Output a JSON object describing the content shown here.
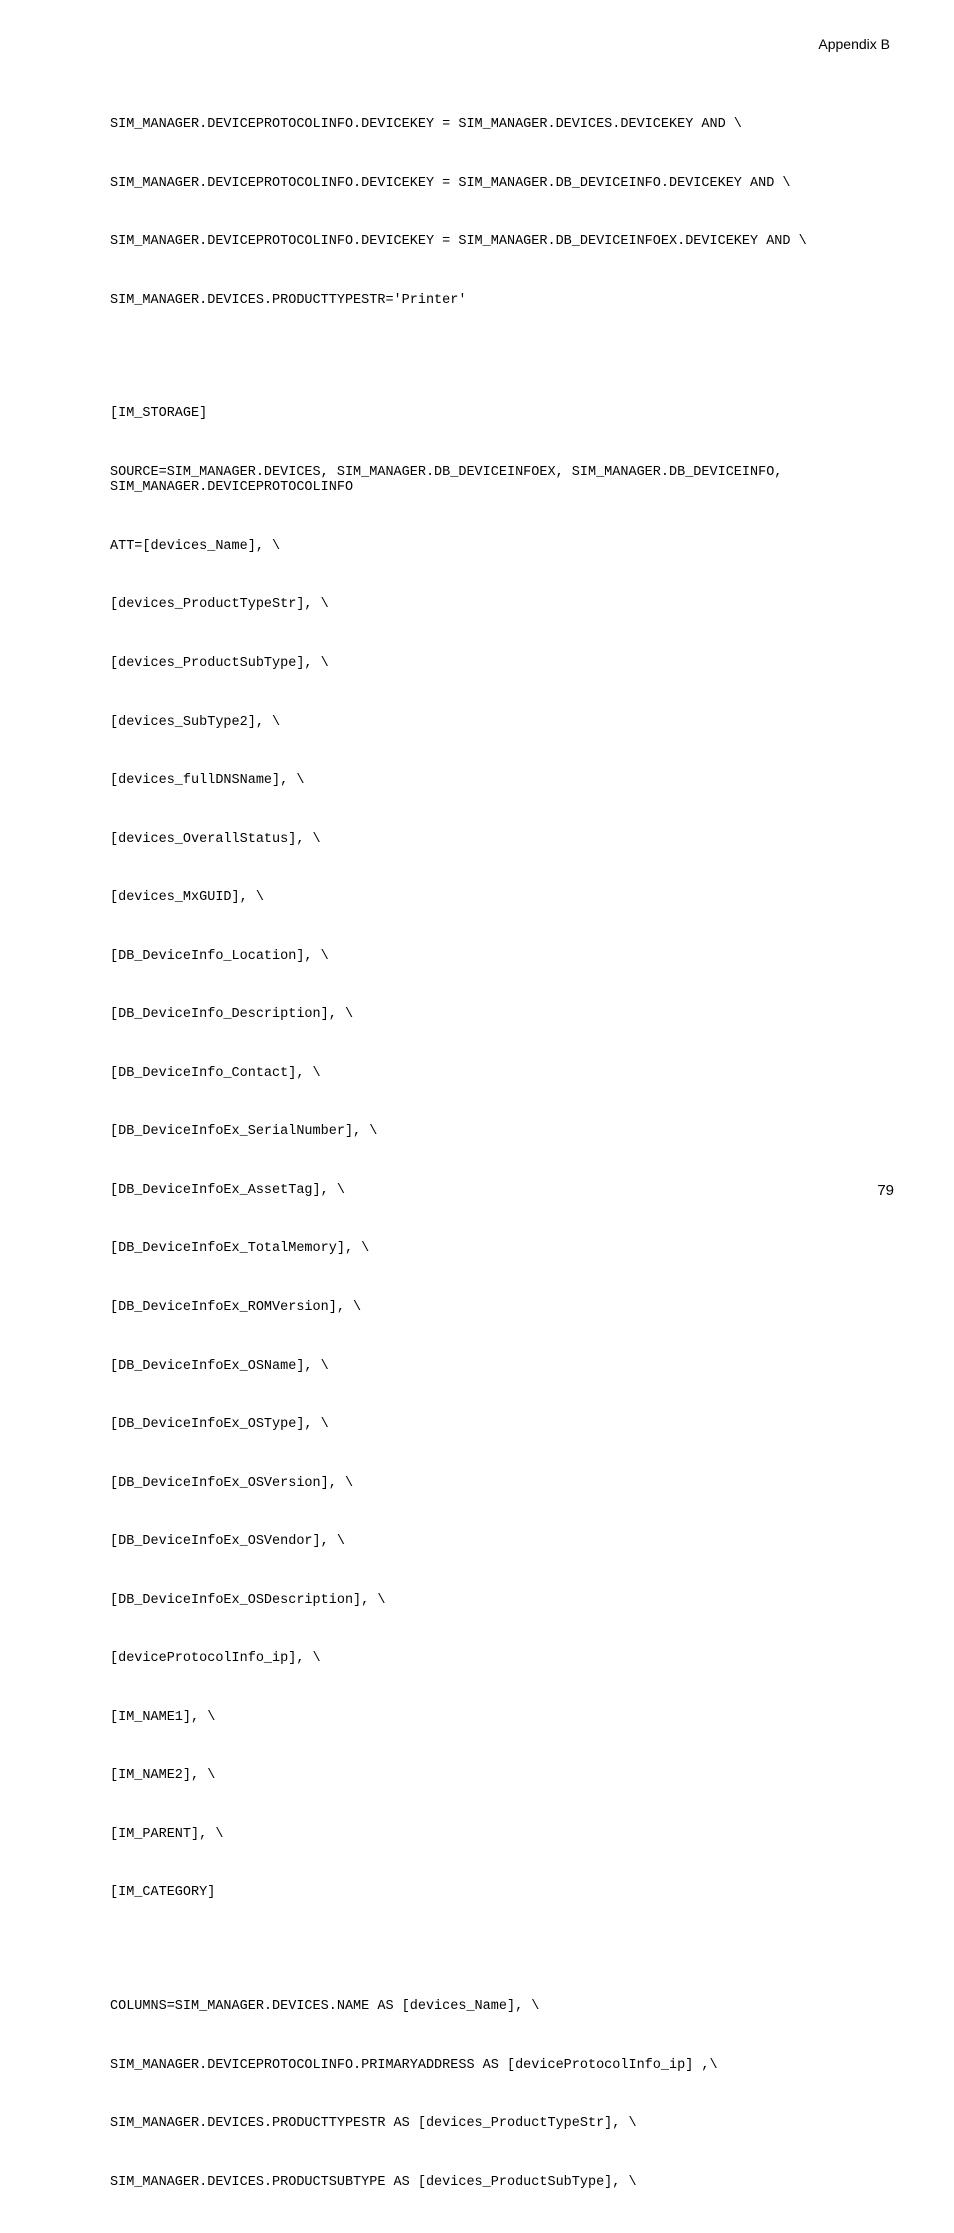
{
  "header": "Appendix B",
  "page_number": "79",
  "code": {
    "l1": "SIM_MANAGER.DEVICEPROTOCOLINFO.DEVICEKEY = SIM_MANAGER.DEVICES.DEVICEKEY AND \\",
    "l2": "SIM_MANAGER.DEVICEPROTOCOLINFO.DEVICEKEY = SIM_MANAGER.DB_DEVICEINFO.DEVICEKEY AND \\",
    "l3": "SIM_MANAGER.DEVICEPROTOCOLINFO.DEVICEKEY = SIM_MANAGER.DB_DEVICEINFOEX.DEVICEKEY AND \\",
    "l4": "SIM_MANAGER.DEVICES.PRODUCTTYPESTR='Printer'",
    "l5": "[IM_STORAGE]",
    "l6": "SOURCE=SIM_MANAGER.DEVICES, SIM_MANAGER.DB_DEVICEINFOEX, SIM_MANAGER.DB_DEVICEINFO, SIM_MANAGER.DEVICEPROTOCOLINFO",
    "l7": "ATT=[devices_Name], \\",
    "l8": "[devices_ProductTypeStr], \\",
    "l9": "[devices_ProductSubType], \\",
    "l10": "[devices_SubType2], \\",
    "l11": "[devices_fullDNSName], \\",
    "l12": "[devices_OverallStatus], \\",
    "l13": "[devices_MxGUID], \\",
    "l14": "[DB_DeviceInfo_Location], \\",
    "l15": "[DB_DeviceInfo_Description], \\",
    "l16": "[DB_DeviceInfo_Contact], \\",
    "l17": "[DB_DeviceInfoEx_SerialNumber], \\",
    "l18": "[DB_DeviceInfoEx_AssetTag], \\",
    "l19": "[DB_DeviceInfoEx_TotalMemory], \\",
    "l20": "[DB_DeviceInfoEx_ROMVersion], \\",
    "l21": "[DB_DeviceInfoEx_OSName], \\",
    "l22": "[DB_DeviceInfoEx_OSType], \\",
    "l23": "[DB_DeviceInfoEx_OSVersion], \\",
    "l24": "[DB_DeviceInfoEx_OSVendor], \\",
    "l25": "[DB_DeviceInfoEx_OSDescription], \\",
    "l26": "[deviceProtocolInfo_ip], \\",
    "l27": "[IM_NAME1], \\",
    "l28": "[IM_NAME2], \\",
    "l29": "[IM_PARENT], \\",
    "l30": "[IM_CATEGORY]",
    "l31": "COLUMNS=SIM_MANAGER.DEVICES.NAME AS [devices_Name], \\",
    "l32": "SIM_MANAGER.DEVICEPROTOCOLINFO.PRIMARYADDRESS AS [deviceProtocolInfo_ip] ,\\",
    "l33": "SIM_MANAGER.DEVICES.PRODUCTTYPESTR AS [devices_ProductTypeStr], \\",
    "l34": "SIM_MANAGER.DEVICES.PRODUCTSUBTYPE AS [devices_ProductSubType], \\"
  }
}
